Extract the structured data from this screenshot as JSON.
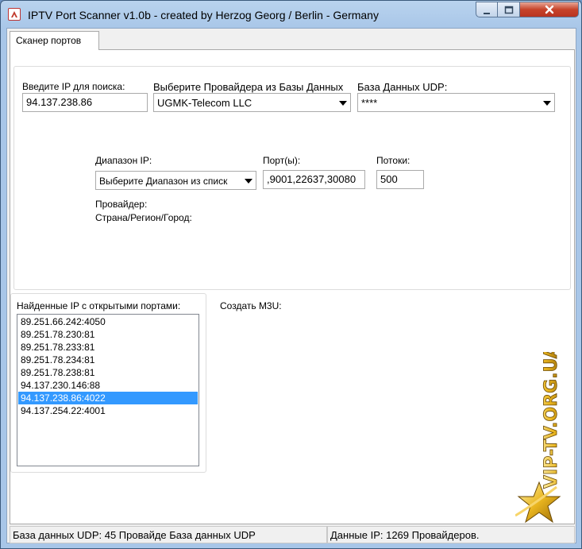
{
  "window": {
    "title": "IPTV Port Scanner v1.0b - created by Herzog Georg / Berlin - Germany"
  },
  "tabs": [
    {
      "label": "Сканер портов",
      "selected": true
    }
  ],
  "search": {
    "ip_label": "Введите IP для поиска:",
    "ip_value": "94.137.238.86",
    "provider_label": "Выберите Провайдера из Базы Данных",
    "provider_value": "UGMK-Telecom LLC",
    "udp_label": "База Данных UDP:",
    "udp_value": "****"
  },
  "range": {
    "range_label": "Диапазон IP:",
    "range_value": "Выберите Диапазон из списк",
    "ports_label": "Порт(ы):",
    "ports_value": ",9001,22637,30080",
    "threads_label": "Потоки:",
    "threads_value": "500",
    "provider_info_label": "Провайдер:",
    "location_label": "Страна/Регион/Город:"
  },
  "found": {
    "label": "Найденные IP с открытыми портами:",
    "items": [
      "89.251.66.242:4050",
      "89.251.78.230:81",
      "89.251.78.233:81",
      "89.251.78.234:81",
      "89.251.78.238:81",
      "94.137.230.146:88",
      "94.137.238.86:4022",
      "94.137.254.22:4001"
    ],
    "selected_index": 6
  },
  "m3u": {
    "label": "Создать M3U:"
  },
  "watermark": {
    "text": "VIP-TV.ORG.UA"
  },
  "statusbar": {
    "left": "База данных UDP: 45 Провайде База данных UDP",
    "right": "Данные IP: 1269 Провайдеров."
  },
  "colors": {
    "selection": "#3399ff",
    "close_button": "#c7432a",
    "watermark_gold": "#e9b51f"
  },
  "icons": {
    "window_buttons": [
      "minimize-icon",
      "maximize-icon",
      "close-icon"
    ],
    "app": "app-icon",
    "dropdown": "chevron-down-icon"
  }
}
